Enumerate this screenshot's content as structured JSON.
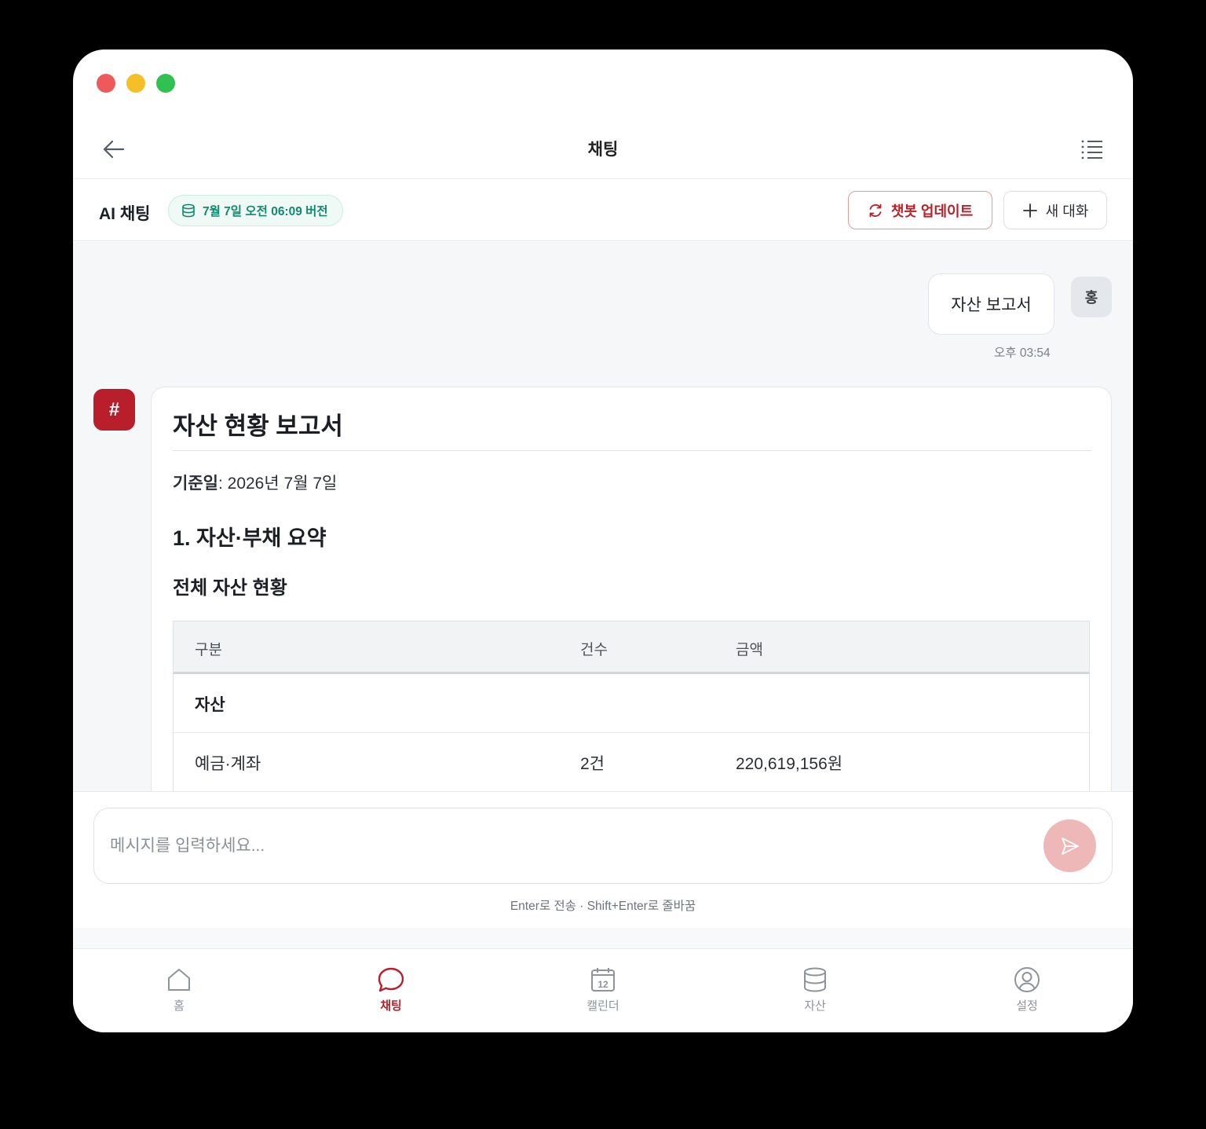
{
  "header": {
    "title": "채팅"
  },
  "subbar": {
    "title": "AI 채팅",
    "version": "7월 7일 오전 06:09 버전",
    "update_button": "챗봇 업데이트",
    "new_chat_button": "새 대화"
  },
  "user_message": {
    "avatar": "홍",
    "text": "자산 보고서",
    "time": "오후 03:54"
  },
  "bot_message": {
    "avatar": "#",
    "title": "자산 현황 보고서",
    "base_date_label": "기준일",
    "base_date_value": ": 2026년 7월 7일",
    "section_heading": "1. 자산·부채 요약",
    "sub_heading": "전체 자산 현황",
    "table": {
      "headers": [
        "구분",
        "건수",
        "금액"
      ],
      "rows": [
        {
          "category": "자산",
          "count": "",
          "amount": ""
        },
        {
          "category": "예금·계좌",
          "count": "2건",
          "amount": "220,619,156원"
        }
      ]
    }
  },
  "composer": {
    "placeholder": "메시지를 입력하세요...",
    "hint": "Enter로 전송 · Shift+Enter로 줄바꿈"
  },
  "tabs": [
    {
      "label": "홈",
      "icon": "home-icon",
      "active": false
    },
    {
      "label": "채팅",
      "icon": "chat-icon",
      "active": true
    },
    {
      "label": "캘린더",
      "icon": "calendar-icon",
      "active": false
    },
    {
      "label": "자산",
      "icon": "database-icon",
      "active": false
    },
    {
      "label": "설정",
      "icon": "user-circle-icon",
      "active": false
    }
  ],
  "calendar_icon_day": "12",
  "colors": {
    "accent": "#b81f2a",
    "version_green": "#138a6e",
    "send_disabled": "#eeb8b9"
  }
}
